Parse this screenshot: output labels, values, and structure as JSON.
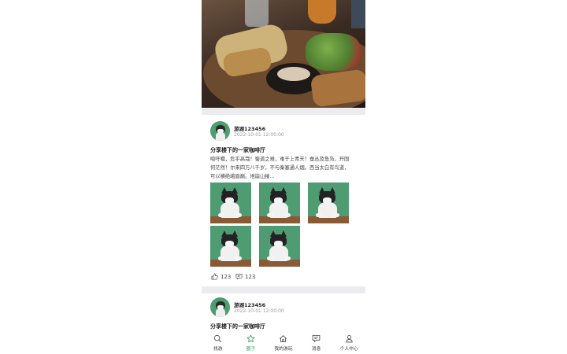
{
  "colors": {
    "accent": "#2e9b5a",
    "text": "#222222",
    "muted": "#999999",
    "divider": "#ececf0"
  },
  "posts": [
    {
      "username": "游湖123456",
      "time": "2022-10-01 12:00:00",
      "title": "分享楼下的一家咖啡厅",
      "content": "噫吁嚱，危乎高哉！蜀道之难，难于上青天！蚕丛及鱼凫，开国何茫然！尔来四万八千岁，不与秦塞通人烟。西当太白有鸟道，可以横绝峨眉巅。地崩山摧...",
      "likes": "123",
      "comments": "123"
    },
    {
      "username": "游湖123456",
      "time": "2022-10-01 12:00:00",
      "title": "分享楼下的一家咖啡厅"
    }
  ],
  "tabbar": {
    "items": [
      {
        "label": "找游",
        "icon": "search-icon"
      },
      {
        "label": "圈子",
        "icon": "star-icon",
        "active": true
      },
      {
        "label": "我的游玩",
        "icon": "home-icon"
      },
      {
        "label": "消息",
        "icon": "message-icon"
      },
      {
        "label": "个人中心",
        "icon": "user-icon"
      }
    ]
  }
}
